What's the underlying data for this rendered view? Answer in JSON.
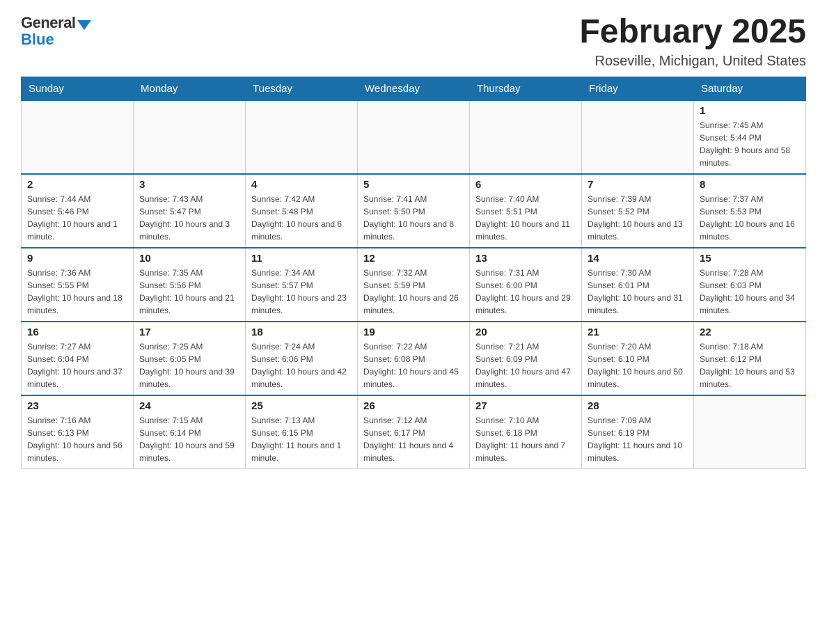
{
  "logo": {
    "general": "General",
    "blue": "Blue"
  },
  "title": "February 2025",
  "subtitle": "Roseville, Michigan, United States",
  "days_of_week": [
    "Sunday",
    "Monday",
    "Tuesday",
    "Wednesday",
    "Thursday",
    "Friday",
    "Saturday"
  ],
  "weeks": [
    {
      "days": [
        {
          "num": "",
          "info": ""
        },
        {
          "num": "",
          "info": ""
        },
        {
          "num": "",
          "info": ""
        },
        {
          "num": "",
          "info": ""
        },
        {
          "num": "",
          "info": ""
        },
        {
          "num": "",
          "info": ""
        },
        {
          "num": "1",
          "info": "Sunrise: 7:45 AM\nSunset: 5:44 PM\nDaylight: 9 hours and 58 minutes."
        }
      ]
    },
    {
      "days": [
        {
          "num": "2",
          "info": "Sunrise: 7:44 AM\nSunset: 5:46 PM\nDaylight: 10 hours and 1 minute."
        },
        {
          "num": "3",
          "info": "Sunrise: 7:43 AM\nSunset: 5:47 PM\nDaylight: 10 hours and 3 minutes."
        },
        {
          "num": "4",
          "info": "Sunrise: 7:42 AM\nSunset: 5:48 PM\nDaylight: 10 hours and 6 minutes."
        },
        {
          "num": "5",
          "info": "Sunrise: 7:41 AM\nSunset: 5:50 PM\nDaylight: 10 hours and 8 minutes."
        },
        {
          "num": "6",
          "info": "Sunrise: 7:40 AM\nSunset: 5:51 PM\nDaylight: 10 hours and 11 minutes."
        },
        {
          "num": "7",
          "info": "Sunrise: 7:39 AM\nSunset: 5:52 PM\nDaylight: 10 hours and 13 minutes."
        },
        {
          "num": "8",
          "info": "Sunrise: 7:37 AM\nSunset: 5:53 PM\nDaylight: 10 hours and 16 minutes."
        }
      ]
    },
    {
      "days": [
        {
          "num": "9",
          "info": "Sunrise: 7:36 AM\nSunset: 5:55 PM\nDaylight: 10 hours and 18 minutes."
        },
        {
          "num": "10",
          "info": "Sunrise: 7:35 AM\nSunset: 5:56 PM\nDaylight: 10 hours and 21 minutes."
        },
        {
          "num": "11",
          "info": "Sunrise: 7:34 AM\nSunset: 5:57 PM\nDaylight: 10 hours and 23 minutes."
        },
        {
          "num": "12",
          "info": "Sunrise: 7:32 AM\nSunset: 5:59 PM\nDaylight: 10 hours and 26 minutes."
        },
        {
          "num": "13",
          "info": "Sunrise: 7:31 AM\nSunset: 6:00 PM\nDaylight: 10 hours and 29 minutes."
        },
        {
          "num": "14",
          "info": "Sunrise: 7:30 AM\nSunset: 6:01 PM\nDaylight: 10 hours and 31 minutes."
        },
        {
          "num": "15",
          "info": "Sunrise: 7:28 AM\nSunset: 6:03 PM\nDaylight: 10 hours and 34 minutes."
        }
      ]
    },
    {
      "days": [
        {
          "num": "16",
          "info": "Sunrise: 7:27 AM\nSunset: 6:04 PM\nDaylight: 10 hours and 37 minutes."
        },
        {
          "num": "17",
          "info": "Sunrise: 7:25 AM\nSunset: 6:05 PM\nDaylight: 10 hours and 39 minutes."
        },
        {
          "num": "18",
          "info": "Sunrise: 7:24 AM\nSunset: 6:06 PM\nDaylight: 10 hours and 42 minutes."
        },
        {
          "num": "19",
          "info": "Sunrise: 7:22 AM\nSunset: 6:08 PM\nDaylight: 10 hours and 45 minutes."
        },
        {
          "num": "20",
          "info": "Sunrise: 7:21 AM\nSunset: 6:09 PM\nDaylight: 10 hours and 47 minutes."
        },
        {
          "num": "21",
          "info": "Sunrise: 7:20 AM\nSunset: 6:10 PM\nDaylight: 10 hours and 50 minutes."
        },
        {
          "num": "22",
          "info": "Sunrise: 7:18 AM\nSunset: 6:12 PM\nDaylight: 10 hours and 53 minutes."
        }
      ]
    },
    {
      "days": [
        {
          "num": "23",
          "info": "Sunrise: 7:16 AM\nSunset: 6:13 PM\nDaylight: 10 hours and 56 minutes."
        },
        {
          "num": "24",
          "info": "Sunrise: 7:15 AM\nSunset: 6:14 PM\nDaylight: 10 hours and 59 minutes."
        },
        {
          "num": "25",
          "info": "Sunrise: 7:13 AM\nSunset: 6:15 PM\nDaylight: 11 hours and 1 minute."
        },
        {
          "num": "26",
          "info": "Sunrise: 7:12 AM\nSunset: 6:17 PM\nDaylight: 11 hours and 4 minutes."
        },
        {
          "num": "27",
          "info": "Sunrise: 7:10 AM\nSunset: 6:18 PM\nDaylight: 11 hours and 7 minutes."
        },
        {
          "num": "28",
          "info": "Sunrise: 7:09 AM\nSunset: 6:19 PM\nDaylight: 11 hours and 10 minutes."
        },
        {
          "num": "",
          "info": ""
        }
      ]
    }
  ]
}
